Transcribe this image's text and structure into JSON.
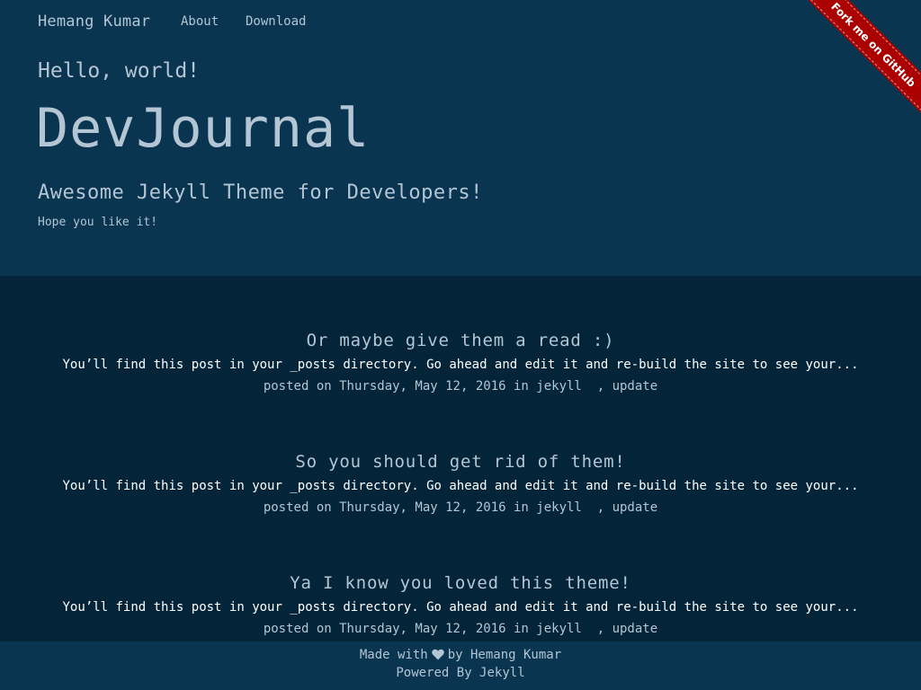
{
  "nav": {
    "brand": "Hemang Kumar",
    "links": [
      "About",
      "Download"
    ]
  },
  "ribbon": {
    "label": "Fork me on GitHub",
    "color": "#aa0000"
  },
  "hero": {
    "hello": "Hello, world!",
    "title": "DevJournal",
    "subtitle": "Awesome Jekyll Theme for Developers!",
    "tagline": "Hope you like it!"
  },
  "posts": [
    {
      "title": "Or maybe give them a read :)",
      "excerpt": "You’ll find this post in your _posts directory. Go ahead and edit it and re-build the site to see your...",
      "meta_prefix": "posted on Thursday, May 12, 2016 in",
      "tags": [
        "jekyll",
        "update"
      ]
    },
    {
      "title": "So you should get rid of them!",
      "excerpt": "You’ll find this post in your _posts directory. Go ahead and edit it and re-build the site to see your...",
      "meta_prefix": "posted on Thursday, May 12, 2016 in",
      "tags": [
        "jekyll",
        "update"
      ]
    },
    {
      "title": "Ya I know you loved this theme!",
      "excerpt": "You’ll find this post in your _posts directory. Go ahead and edit it and re-build the site to see your...",
      "meta_prefix": "posted on Thursday, May 12, 2016 in",
      "tags": [
        "jekyll",
        "update"
      ]
    }
  ],
  "footer": {
    "made_with": "Made with",
    "by": "by Hemang Kumar",
    "heart_icon": "heart-icon",
    "powered": "Powered By Jekyll"
  },
  "colors": {
    "header_bg": "#093551",
    "body_bg": "#042539",
    "text": "#b4c5d3",
    "excerpt": "#ffffff"
  }
}
